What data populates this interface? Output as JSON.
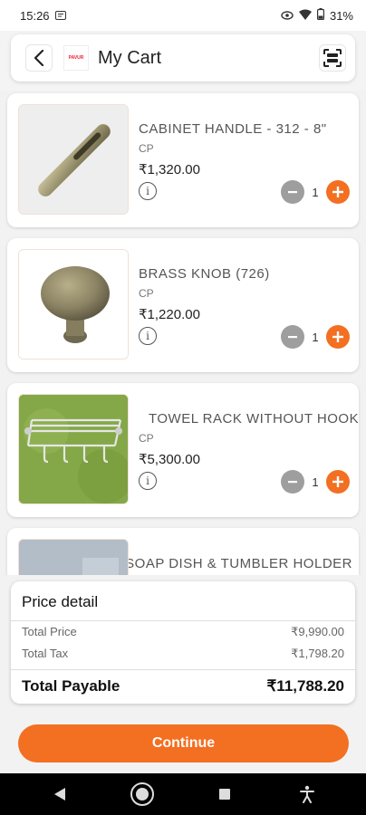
{
  "status_bar": {
    "time": "15:26",
    "battery": "31%",
    "icons": [
      "message-icon",
      "eye-icon",
      "wifi-icon",
      "battery-icon"
    ]
  },
  "header": {
    "title": "My Cart",
    "logo_text": "PAVUR",
    "back_icon": "chevron-left-icon",
    "scan_icon": "scan-icon"
  },
  "cart": {
    "items": [
      {
        "name": "CABINET HANDLE - 312 - 8\"",
        "finish": "CP",
        "price": "₹1,320.00",
        "qty": "1"
      },
      {
        "name": "BRASS KNOB (726)",
        "finish": "CP",
        "price": "₹1,220.00",
        "qty": "1"
      },
      {
        "name": "TOWEL RACK WITHOUT HOOK",
        "finish": "CP",
        "price": "₹5,300.00",
        "qty": "1"
      },
      {
        "name": "SS SOAP DISH & TUMBLER HOLDER",
        "finish": "",
        "price": "",
        "qty": ""
      }
    ]
  },
  "price_detail": {
    "title": "Price detail",
    "total_price_label": "Total Price",
    "total_price_value": "₹9,990.00",
    "total_tax_label": "Total Tax",
    "total_tax_value": "₹1,798.20",
    "total_payable_label": "Total Payable",
    "total_payable_value": "₹11,788.20"
  },
  "actions": {
    "continue_label": "Continue"
  },
  "colors": {
    "accent": "#f36f21",
    "minus": "#9e9e9e"
  }
}
